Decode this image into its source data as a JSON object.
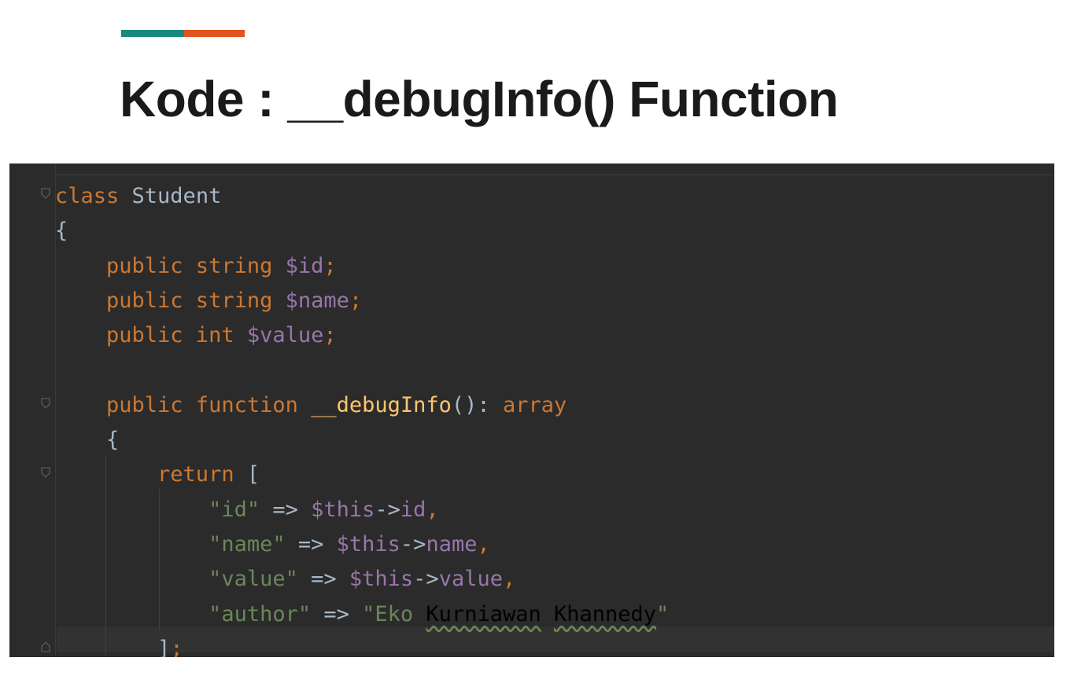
{
  "slide": {
    "title": "Kode : __debugInfo() Function",
    "accent_colors": {
      "teal": "#1a8a7e",
      "orange": "#e2541d"
    }
  },
  "editor": {
    "theme": "darcula",
    "colors": {
      "background": "#2b2b2b",
      "keyword": "#cc7832",
      "identifier": "#a9b7c6",
      "variable": "#9876aa",
      "function": "#ffc66d",
      "string": "#6a8759"
    },
    "lines": [
      [
        {
          "t": "kw",
          "v": "class"
        },
        {
          "t": "cls",
          "v": " Student"
        }
      ],
      [
        {
          "t": "punc",
          "v": "{"
        }
      ],
      [
        {
          "t": "kw",
          "v": "    public string "
        },
        {
          "t": "var",
          "v": "$id"
        },
        {
          "t": "kw",
          "v": ";"
        }
      ],
      [
        {
          "t": "kw",
          "v": "    public string "
        },
        {
          "t": "var",
          "v": "$name"
        },
        {
          "t": "kw",
          "v": ";"
        }
      ],
      [
        {
          "t": "kw",
          "v": "    public int "
        },
        {
          "t": "var",
          "v": "$value"
        },
        {
          "t": "kw",
          "v": ";"
        }
      ],
      [],
      [
        {
          "t": "kw",
          "v": "    public function "
        },
        {
          "t": "fn",
          "v": "__debugInfo"
        },
        {
          "t": "punc",
          "v": "(): "
        },
        {
          "t": "kw",
          "v": "array"
        }
      ],
      [
        {
          "t": "punc",
          "v": "    {"
        }
      ],
      [
        {
          "t": "kw",
          "v": "        return "
        },
        {
          "t": "punc",
          "v": "["
        }
      ],
      [
        {
          "t": "str",
          "v": "            \"id\""
        },
        {
          "t": "punc",
          "v": " => "
        },
        {
          "t": "var",
          "v": "$this"
        },
        {
          "t": "punc",
          "v": "->"
        },
        {
          "t": "var",
          "v": "id"
        },
        {
          "t": "comma",
          "v": ","
        }
      ],
      [
        {
          "t": "str",
          "v": "            \"name\""
        },
        {
          "t": "punc",
          "v": " => "
        },
        {
          "t": "var",
          "v": "$this"
        },
        {
          "t": "punc",
          "v": "->"
        },
        {
          "t": "var",
          "v": "name"
        },
        {
          "t": "comma",
          "v": ","
        }
      ],
      [
        {
          "t": "str",
          "v": "            \"value\""
        },
        {
          "t": "punc",
          "v": " => "
        },
        {
          "t": "var",
          "v": "$this"
        },
        {
          "t": "punc",
          "v": "->"
        },
        {
          "t": "var",
          "v": "value"
        },
        {
          "t": "comma",
          "v": ","
        }
      ],
      [
        {
          "t": "str",
          "v": "            \"author\""
        },
        {
          "t": "punc",
          "v": " => "
        },
        {
          "t": "str",
          "v": "\"Eko "
        },
        {
          "t": "squig",
          "v": "Kurniawan"
        },
        {
          "t": "str",
          "v": " "
        },
        {
          "t": "squig",
          "v": "Khannedy"
        },
        {
          "t": "str",
          "v": "\""
        }
      ],
      [
        {
          "t": "punc",
          "v": "        ]"
        },
        {
          "t": "comma",
          "v": ";"
        }
      ]
    ]
  }
}
